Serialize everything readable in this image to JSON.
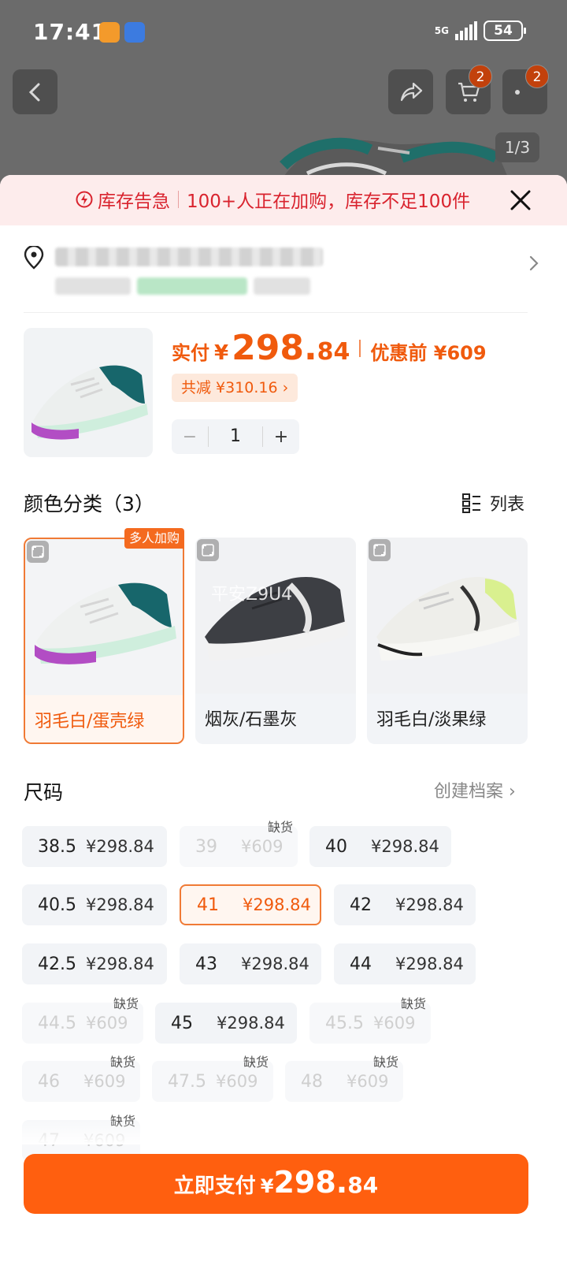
{
  "status_bar": {
    "time": "17:41",
    "network": "5G",
    "battery": "54"
  },
  "nav": {
    "cart_badge": "2",
    "more_badge": "2",
    "image_counter": "1/3"
  },
  "alert": {
    "title": "库存告急",
    "message": "100+人正在加购，库存不足100件"
  },
  "price": {
    "label": "实付",
    "currency": "¥",
    "integer": "298.",
    "decimal": "84",
    "original": "优惠前 ¥609",
    "discount": "共减 ¥310.16 ›"
  },
  "quantity": {
    "value": "1",
    "minus": "−",
    "plus": "+"
  },
  "colors": {
    "title": "颜色分类（3）",
    "list_label": "列表",
    "popular_tag": "多人加购",
    "watermark": "平安Z9U4",
    "items": [
      {
        "name": "羽毛白/蛋壳绿",
        "selected": true
      },
      {
        "name": "烟灰/石墨灰",
        "selected": false
      },
      {
        "name": "羽毛白/淡果绿",
        "selected": false
      }
    ]
  },
  "sizes": {
    "title": "尺码",
    "profile_link": "创建档案",
    "oos_label": "缺货",
    "items": [
      {
        "size": "38.5",
        "price": "¥298.84"
      },
      {
        "size": "39",
        "price": "¥609"
      },
      {
        "size": "40",
        "price": "¥298.84"
      },
      {
        "size": "40.5",
        "price": "¥298.84"
      },
      {
        "size": "41",
        "price": "¥298.84"
      },
      {
        "size": "42",
        "price": "¥298.84"
      },
      {
        "size": "42.5",
        "price": "¥298.84"
      },
      {
        "size": "43",
        "price": "¥298.84"
      },
      {
        "size": "44",
        "price": "¥298.84"
      },
      {
        "size": "44.5",
        "price": "¥609"
      },
      {
        "size": "45",
        "price": "¥298.84"
      },
      {
        "size": "45.5",
        "price": "¥609"
      },
      {
        "size": "46",
        "price": "¥609"
      },
      {
        "size": "47.5",
        "price": "¥609"
      },
      {
        "size": "48",
        "price": "¥609"
      },
      {
        "size": "47",
        "price": "¥609"
      }
    ]
  },
  "pay": {
    "label": "立即支付",
    "currency": "¥",
    "integer": "298.",
    "decimal": "84"
  },
  "colors_palette": {
    "accent": "#f05a0d",
    "alert_red": "#d9232e",
    "pay_button": "#ff5f0f"
  }
}
